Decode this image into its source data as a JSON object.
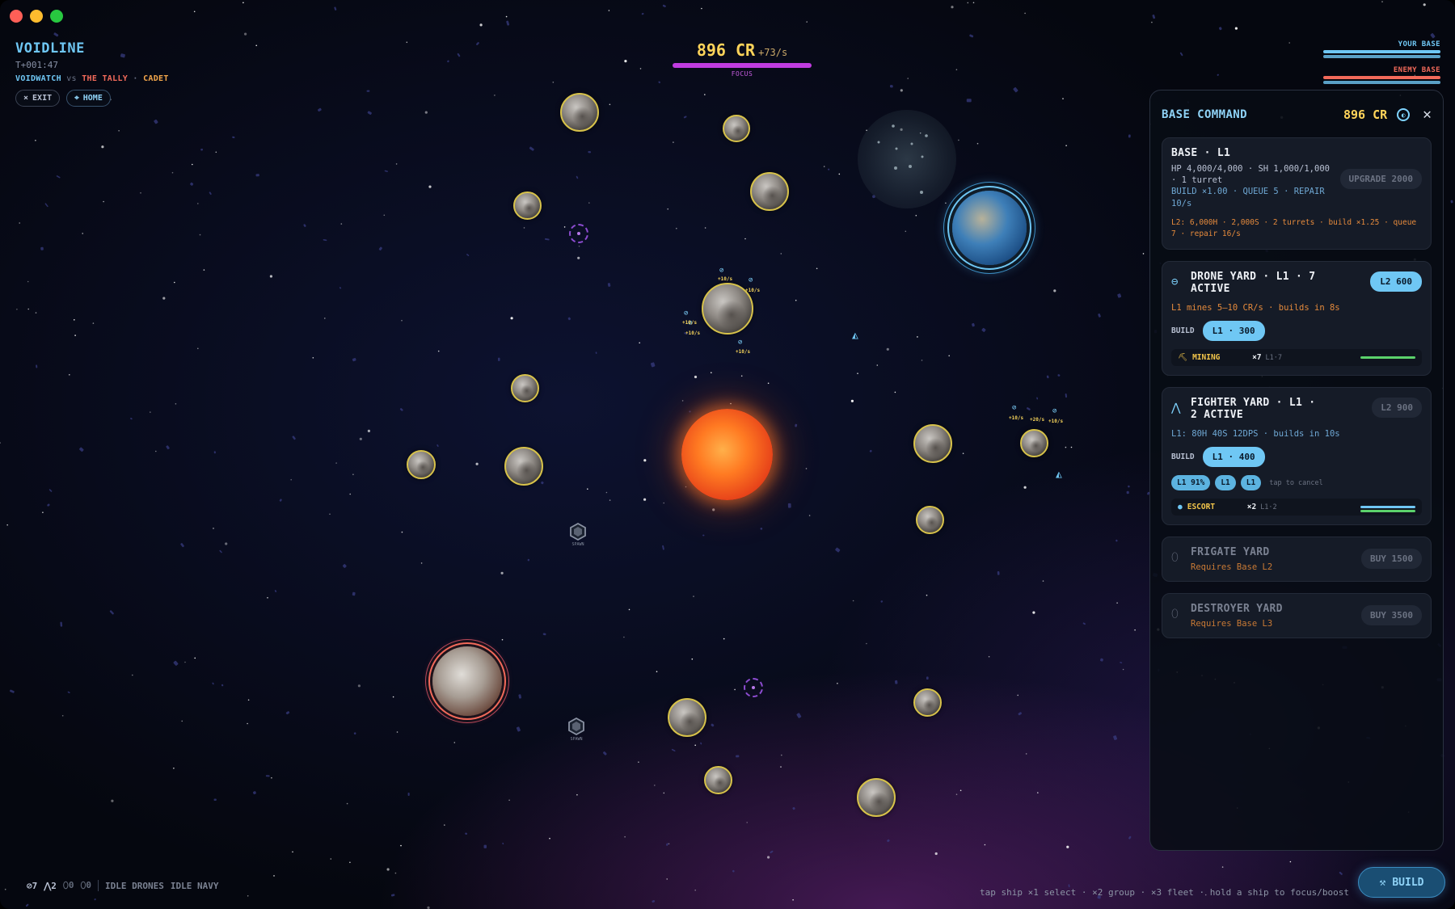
{
  "game": {
    "title": "VOIDLINE",
    "timer": "T+001:47",
    "player": "VOIDWATCH",
    "vs": "vs",
    "enemy": "THE TALLY",
    "separator": "·",
    "difficulty": "CADET",
    "exit_label": "EXIT",
    "home_label": "HOME"
  },
  "economy": {
    "credits": "896 CR",
    "rate": "+73/s",
    "focus_label": "FOCUS"
  },
  "base_health": {
    "your_label": "YOUR BASE",
    "your_fraction": 1.0,
    "enemy_label": "ENEMY BASE",
    "enemy_fraction": 1.0
  },
  "map": {
    "hex_label": "SPAWN",
    "yields": [
      "+10/s",
      "+10/s",
      "+10/s",
      "+10/s",
      "+10/s",
      "+10/s",
      "+20/s",
      "+10/s"
    ]
  },
  "panel": {
    "title": "BASE COMMAND",
    "credits": "896 CR",
    "base": {
      "title": "BASE · L1",
      "stats": "HP 4,000/4,000 · SH 1,000/1,000 · 1 turret",
      "build": "BUILD ×1.00 · QUEUE 5 · REPAIR 10/s",
      "next": "L2: 6,000H · 2,000S · 2 turrets · build ×1.25 · queue 7 · repair 16/s",
      "upgrade_label": "UPGRADE 2000"
    },
    "drone_yard": {
      "title": "DRONE YARD · L1 · 7 ACTIVE",
      "upgrade_label": "L2 600",
      "desc": "L1 mines 5–10 CR/s · builds in 8s",
      "build_label": "BUILD",
      "build_button": "L1 · 300",
      "task_name": "MINING",
      "task_count": "×7",
      "task_level": "L1·7"
    },
    "fighter_yard": {
      "title": "FIGHTER YARD · L1 · 2 ACTIVE",
      "upgrade_label": "L2 900",
      "desc": "L1: 80H 40S 12DPS · builds in 10s",
      "build_label": "BUILD",
      "build_button": "L1 · 400",
      "queue": [
        "L1 91%",
        "L1",
        "L1"
      ],
      "queue_hint": "tap to cancel",
      "task_name": "ESCORT",
      "task_count": "×2",
      "task_level": "L1·2"
    },
    "frigate_yard": {
      "title": "FRIGATE YARD",
      "requirement": "Requires Base L2",
      "buy_label": "BUY 1500"
    },
    "destroyer_yard": {
      "title": "DESTROYER YARD",
      "requirement": "Requires Base L3",
      "buy_label": "BUY 3500"
    }
  },
  "fleet_summary": {
    "drones": "7",
    "fighters": "2",
    "frigates": "0",
    "destroyers": "0",
    "idle_drones": "IDLE DRONES",
    "idle_navy": "IDLE NAVY"
  },
  "hint": "tap ship ×1 select · ×2 group · ×3 fleet · hold a ship to focus/boost",
  "build_fab_label": "BUILD",
  "colors": {
    "accent": "#6fc7f4",
    "credits": "#ffd45a",
    "enemy": "#f26a5a",
    "focus": "#c03ce0",
    "warning": "#e58a3c"
  }
}
